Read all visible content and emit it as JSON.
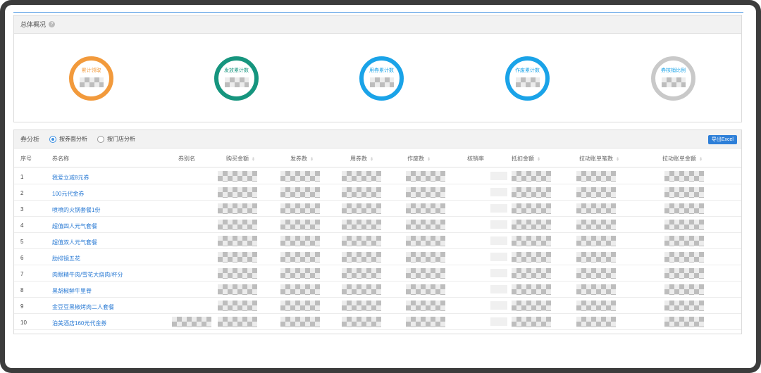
{
  "overview": {
    "title": "总体概况",
    "help_icon": "?",
    "rings": [
      {
        "label": "累计领取",
        "color": "#f29a3c"
      },
      {
        "label": "发放累计数",
        "color": "#16957e"
      },
      {
        "label": "用券累计数",
        "color": "#1aa3e8"
      },
      {
        "label": "作废累计数",
        "color": "#1aa3e8"
      },
      {
        "label": "券核销比例",
        "color": "#c9c9c9"
      }
    ]
  },
  "analysis": {
    "title": "券分析",
    "radio_by_coupon": "按券面分析",
    "radio_by_store": "按门店分析",
    "export_label": "导出Excel"
  },
  "table": {
    "headers": [
      "序号",
      "券名称",
      "券别名",
      "购买金额",
      "发券数",
      "用券数",
      "作废数",
      "核销率",
      "抵扣金额",
      "拉动账单笔数",
      "拉动账单金额"
    ],
    "rows": [
      {
        "idx": "1",
        "name": "我爱立减8元券"
      },
      {
        "idx": "2",
        "name": "100元代金券"
      },
      {
        "idx": "3",
        "name": "喷喷的火锅套餐1份"
      },
      {
        "idx": "4",
        "name": "超值四人元气套餐"
      },
      {
        "idx": "5",
        "name": "超值双人元气套餐"
      },
      {
        "idx": "6",
        "name": "肋排镜五花"
      },
      {
        "idx": "7",
        "name": "肉眼精牛肉/雪花大烧肉/杯分"
      },
      {
        "idx": "8",
        "name": "黑胡椒鲜牛里脊"
      },
      {
        "idx": "9",
        "name": "金豆豆黑椒烤肉二人套餐"
      },
      {
        "idx": "10",
        "name": "泊美酒店160元代金券"
      }
    ]
  },
  "icons": {
    "help": "help-icon",
    "sort": "sort-icon",
    "radio_checked": "radio-checked-icon",
    "radio_unchecked": "radio-unchecked-icon"
  }
}
